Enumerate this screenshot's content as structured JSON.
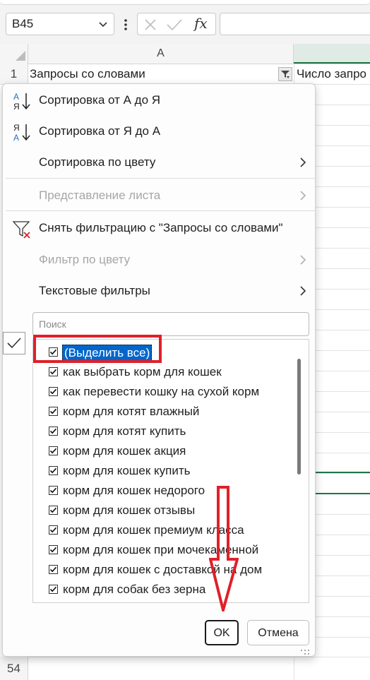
{
  "formula_bar": {
    "name_box": "B45",
    "fx": "fx"
  },
  "grid": {
    "col_a": "A",
    "row1_num": "1",
    "row_bottom_num": "54",
    "cell_a1": "Запросы со словами",
    "cell_b1": "Число запро"
  },
  "menu": {
    "sort_asc": "Сортировка от А до Я",
    "sort_desc": "Сортировка от Я до А",
    "sort_color": "Сортировка по цвету",
    "sheet_view": "Представление листа",
    "clear_filter": "Снять фильтрацию с \"Запросы со словами\"",
    "filter_color": "Фильтр по цвету",
    "text_filters": "Текстовые фильтры"
  },
  "search": {
    "placeholder": "Поиск"
  },
  "list": {
    "items": [
      "(Выделить все)",
      "как выбрать корм для кошек",
      "как перевести кошку на сухой корм",
      "корм для котят влажный",
      "корм для котят купить",
      "корм для кошек акция",
      "корм для кошек купить",
      "корм для кошек недорого",
      "корм для кошек отзывы",
      "корм для кошек премиум класса",
      "корм для кошек при мочекаменной",
      "корм для кошек с доставкой на дом",
      "корм для собак без зерна"
    ]
  },
  "buttons": {
    "ok": "OK",
    "cancel": "Отмена"
  },
  "colors": {
    "excel_green": "#217346",
    "selection_blue": "#0066cc",
    "annotation_red": "#e0202a"
  }
}
